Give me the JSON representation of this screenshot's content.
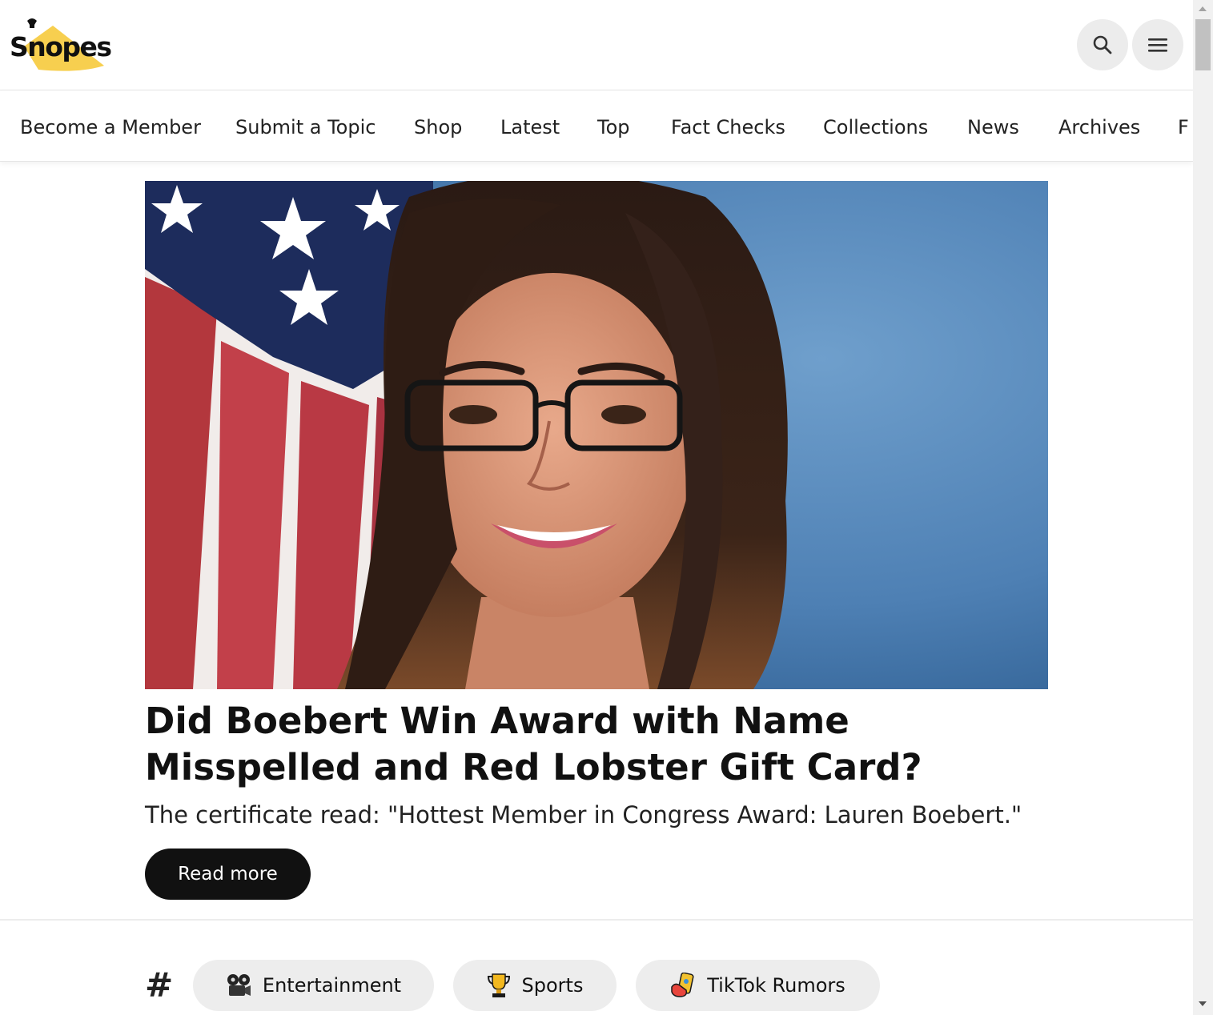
{
  "header": {
    "logo_text": "Snopes",
    "search_icon": "search-icon",
    "menu_icon": "menu-icon"
  },
  "nav": {
    "items": [
      {
        "label": "Become a Member"
      },
      {
        "label": "Submit a Topic"
      },
      {
        "label": "Shop"
      },
      {
        "label": "Latest"
      },
      {
        "label": "Top"
      },
      {
        "label": "Fact Checks"
      },
      {
        "label": "Collections"
      },
      {
        "label": "News"
      },
      {
        "label": "Archives"
      },
      {
        "label": "F"
      }
    ]
  },
  "hero": {
    "title": "Did Boebert Win Award with Name Misspelled and Red Lobster Gift Card?",
    "subtitle": "The certificate read: \"Hottest Member in Congress Award: Lauren Boebert.\"",
    "button_label": "Read more"
  },
  "topics": {
    "hash_symbol": "#",
    "chips": [
      {
        "label": "Entertainment",
        "icon": "film-projector-icon"
      },
      {
        "label": "Sports",
        "icon": "trophy-icon"
      },
      {
        "label": "TikTok Rumors",
        "icon": "selfie-phone-icon"
      }
    ]
  },
  "colors": {
    "logo_yellow": "#f7cf4f",
    "button_dark": "#111111",
    "chip_bg": "#ededed",
    "icon_button_bg": "#ececec"
  }
}
